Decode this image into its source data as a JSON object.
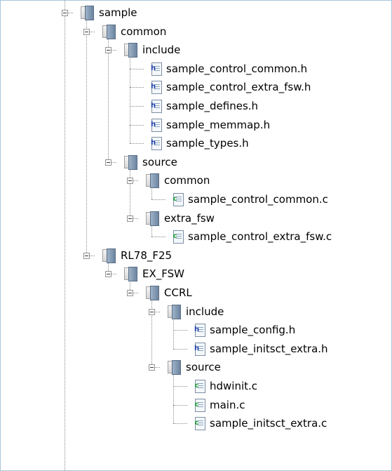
{
  "colors": {
    "header_badge": "#1f3fa8",
    "source_badge": "#1a9a2e"
  },
  "icons": {
    "folder": "folder-icon",
    "header_file": "h-file-icon",
    "source_file": "c-file-icon",
    "collapse": "collapse-icon"
  },
  "badges": {
    "header": "h",
    "source": "c"
  },
  "tree": [
    {
      "label": "sample",
      "type": "folder",
      "depth": 0,
      "expanded": true
    },
    {
      "label": "common",
      "type": "folder",
      "depth": 1,
      "expanded": true
    },
    {
      "label": "include",
      "type": "folder",
      "depth": 2,
      "expanded": true
    },
    {
      "label": "sample_control_common.h",
      "type": "header",
      "depth": 3
    },
    {
      "label": "sample_control_extra_fsw.h",
      "type": "header",
      "depth": 3
    },
    {
      "label": "sample_defines.h",
      "type": "header",
      "depth": 3
    },
    {
      "label": "sample_memmap.h",
      "type": "header",
      "depth": 3
    },
    {
      "label": "sample_types.h",
      "type": "header",
      "depth": 3
    },
    {
      "label": "source",
      "type": "folder",
      "depth": 2,
      "expanded": true
    },
    {
      "label": "common",
      "type": "folder",
      "depth": 3,
      "expanded": true
    },
    {
      "label": "sample_control_common.c",
      "type": "source",
      "depth": 4
    },
    {
      "label": "extra_fsw",
      "type": "folder",
      "depth": 3,
      "expanded": true
    },
    {
      "label": "sample_control_extra_fsw.c",
      "type": "source",
      "depth": 4
    },
    {
      "label": "RL78_F25",
      "type": "folder",
      "depth": 1,
      "expanded": true
    },
    {
      "label": "EX_FSW",
      "type": "folder",
      "depth": 2,
      "expanded": true
    },
    {
      "label": "CCRL",
      "type": "folder",
      "depth": 3,
      "expanded": true
    },
    {
      "label": "include",
      "type": "folder",
      "depth": 4,
      "expanded": true
    },
    {
      "label": "sample_config.h",
      "type": "header",
      "depth": 5
    },
    {
      "label": "sample_initsct_extra.h",
      "type": "header",
      "depth": 5
    },
    {
      "label": "source",
      "type": "folder",
      "depth": 4,
      "expanded": true
    },
    {
      "label": "hdwinit.c",
      "type": "source",
      "depth": 5
    },
    {
      "label": "main.c",
      "type": "source",
      "depth": 5
    },
    {
      "label": "sample_initsct_extra.c",
      "type": "source",
      "depth": 5
    }
  ]
}
